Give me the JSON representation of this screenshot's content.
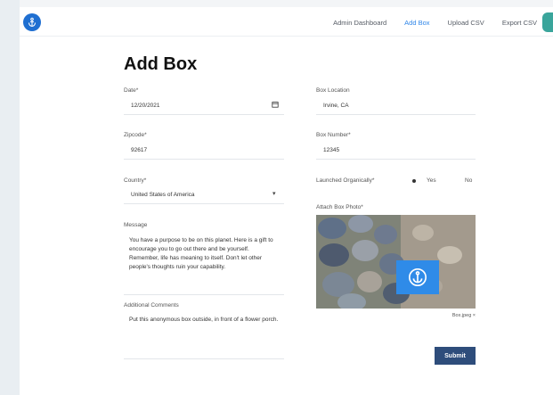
{
  "nav": {
    "items": [
      "Admin Dashboard",
      "Add Box",
      "Upload CSV",
      "Export CSV"
    ],
    "active_index": 1
  },
  "page_title": "Add Box",
  "fields": {
    "date": {
      "label": "Date*",
      "value": "12/20/2021"
    },
    "box_location": {
      "label": "Box Location",
      "value": "Irvine, CA"
    },
    "zipcode": {
      "label": "Zipcode*",
      "value": "92617"
    },
    "box_number": {
      "label": "Box Number*",
      "value": "12345"
    },
    "country": {
      "label": "Country*",
      "value": "United States of America"
    },
    "launched": {
      "label": "Launched Organically*",
      "yes": "Yes",
      "no": "No",
      "selected": "Yes"
    },
    "message": {
      "label": "Message",
      "value": "You have a purpose to be on this planet. Here is a gift to encourage you to go out there and be yourself. Remember, life has meaning to itself. Don't let other people's thoughts ruin your capability."
    },
    "attach_photo": {
      "label": "Attach Box Photo*",
      "filename": "Box.jpeg ×"
    },
    "comments": {
      "label": "Additional Comments",
      "value": "Put this anonymous box outside, in front of a flower porch."
    }
  },
  "submit_label": "Submit",
  "colors": {
    "accent": "#2f86e8",
    "submit": "#2e4d7b",
    "logo": "#1f6fd1"
  }
}
